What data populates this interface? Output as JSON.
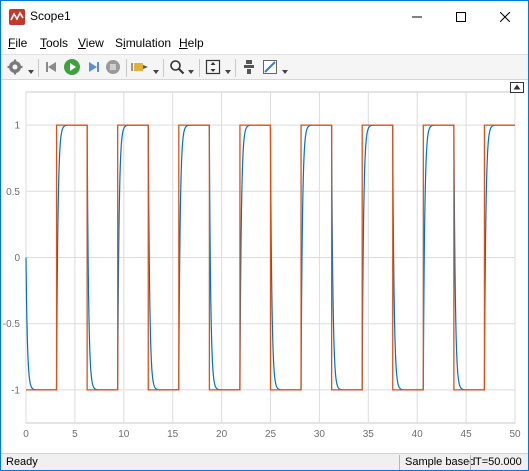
{
  "window": {
    "title": "Scope1"
  },
  "menu": {
    "file": {
      "label": "File",
      "accel": "F",
      "rest": "ile"
    },
    "tools": {
      "label": "Tools",
      "accel": "T",
      "rest": "ools"
    },
    "view": {
      "label": "View",
      "accel": "V",
      "rest": "iew"
    },
    "simulation": {
      "label": "Simulation",
      "accel_pre": "S",
      "accel": "i",
      "rest": "mulation"
    },
    "help": {
      "label": "Help",
      "accel": "H",
      "rest": "elp"
    }
  },
  "toolbar": {
    "icons": [
      "gear-icon",
      "step-back-icon",
      "run-icon",
      "step-forward-icon",
      "stop-icon",
      "highlight-icon",
      "zoom-icon",
      "fit-to-view-icon",
      "bring-to-front-icon",
      "edit-style-icon"
    ]
  },
  "colors": {
    "accent": "#0078d7",
    "series_blue": "#0072bd",
    "series_orange": "#d95319",
    "grid": "#dcdcdc",
    "axis_text": "#6e6e6e"
  },
  "status": {
    "ready": "Ready",
    "sample_mode": "Sample based",
    "time": "T=50.000"
  },
  "chart_data": {
    "type": "line",
    "title": "",
    "xlabel": "",
    "ylabel": "",
    "xlim": [
      0,
      50
    ],
    "ylim": [
      -1.25,
      1.25
    ],
    "x_ticks": [
      "0",
      "5",
      "10",
      "15",
      "20",
      "25",
      "30",
      "35",
      "40",
      "45",
      "50"
    ],
    "y_ticks": [
      "1",
      "0.5",
      "0",
      "-0.5",
      "-1"
    ],
    "grid": true,
    "period": 6.25,
    "series": [
      {
        "color": "#d95319",
        "type": "square-wave",
        "x": [
          0,
          3.125,
          3.125,
          6.25,
          6.25,
          9.375,
          9.375,
          12.5,
          12.5,
          15.625,
          15.625,
          18.75,
          18.75,
          21.875,
          21.875,
          25,
          25,
          28.125,
          28.125,
          31.25,
          31.25,
          34.375,
          34.375,
          37.5,
          37.5,
          40.625,
          40.625,
          43.75,
          43.75,
          46.875,
          46.875,
          50
        ],
        "y": [
          -1,
          -1,
          1,
          1,
          -1,
          -1,
          1,
          1,
          -1,
          -1,
          1,
          1,
          -1,
          -1,
          1,
          1,
          -1,
          -1,
          1,
          1,
          -1,
          -1,
          1,
          1,
          -1,
          -1,
          1,
          1,
          -1,
          -1,
          1,
          1
        ]
      },
      {
        "color": "#0072bd",
        "type": "first-order-response",
        "time_constant": 0.15
      }
    ]
  }
}
